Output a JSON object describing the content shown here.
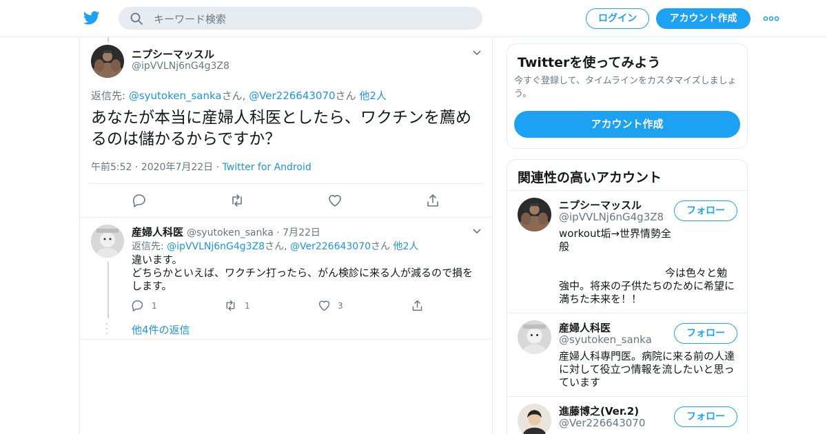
{
  "header": {
    "search_placeholder": "キーワード検索",
    "login_label": "ログイン",
    "signup_label": "アカウント作成",
    "accent_color": "#1da1f2"
  },
  "main_tweet": {
    "display_name": "ニプシーマッスル",
    "handle": "@ipVVLNj6nG4g3Z8",
    "reply_prefix": "返信先: ",
    "reply_to_1": "@syutoken_sanka",
    "reply_suffix_1": "さん, ",
    "reply_to_2": "@Ver226643070",
    "reply_suffix_2": "さん",
    "reply_others": "他2人",
    "text": "あなたが本当に産婦人科医としたら、ワクチンを薦めるのは儲かるからですか？",
    "time": "午前5:52",
    "date": "2020年7月22日",
    "source": "Twitter for Android",
    "sep": "·"
  },
  "reply_tweet": {
    "display_name": "産婦人科医",
    "handle": "@syutoken_sanka",
    "date": "7月22日",
    "sep": "·",
    "reply_prefix": "返信先: ",
    "reply_to_1": "@ipVVLNj6nG4g3Z8",
    "reply_suffix_1": "さん, ",
    "reply_to_2": "@Ver226643070",
    "reply_suffix_2": "さん",
    "reply_others": "他2人",
    "line_1": "違います。",
    "line_2": "どちらかといえば、ワクチン打ったら、がん検診に来る人が減るので損を",
    "line_3": "します。",
    "reply_count": "1",
    "retweet_count": "1",
    "like_count": "3",
    "more_replies": "他4件の返信"
  },
  "signup_card": {
    "title": "Twitterを使ってみよう",
    "subtitle": "今すぐ登録して、タイムラインをカスタマイズしましょう。",
    "button": "アカウント作成"
  },
  "related_card": {
    "title": "関連性の高いアカウント",
    "follow_label": "フォロー",
    "accounts": [
      {
        "name": "ニプシーマッスル",
        "handle": "@ipVVLNj6nG4g3Z8",
        "bio_1": "workout垢→世界情勢全",
        "bio_2": "般",
        "bio_3": "今は色々と勉",
        "bio_4": "強中。将来の子供たちのために希望に",
        "bio_5": "満ちた未来を！！"
      },
      {
        "name": "産婦人科医",
        "handle": "@syutoken_sanka",
        "bio_1": "産婦人科専門医。病院に来る前の人達",
        "bio_2": "に対して役立つ情報を流したいと思っ",
        "bio_3": "ています"
      },
      {
        "name": "進藤博之(Ver.2)",
        "handle": "@Ver226643070"
      }
    ]
  }
}
